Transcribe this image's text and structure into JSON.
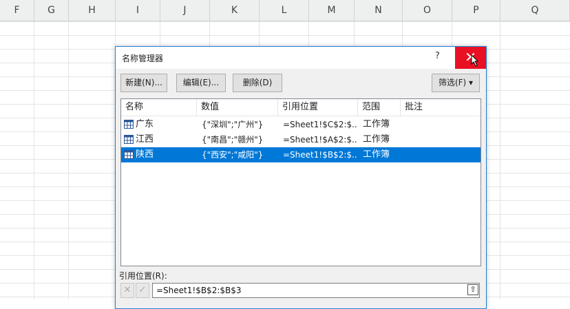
{
  "columns": [
    "F",
    "G",
    "H",
    "I",
    "J",
    "K",
    "L",
    "M",
    "N",
    "O",
    "P",
    "Q"
  ],
  "dialog": {
    "title": "名称管理器",
    "help": "?",
    "close": "✕",
    "buttons": {
      "new": "新建(N)...",
      "edit": "编辑(E)...",
      "delete": "删除(D)",
      "filter": "筛选(F) ▾"
    },
    "headers": [
      "名称",
      "数值",
      "引用位置",
      "范围",
      "批注"
    ],
    "rows": [
      {
        "name": "广东",
        "value": "{\"深圳\";\"广州\"}",
        "ref": "=Sheet1!$C$2:$...",
        "scope": "工作簿",
        "comment": ""
      },
      {
        "name": "江西",
        "value": "{\"南昌\";\"赣州\"}",
        "ref": "=Sheet1!$A$2:$...",
        "scope": "工作簿",
        "comment": ""
      },
      {
        "name": "陕西",
        "value": "{\"西安\";\"咸阳\"}",
        "ref": "=Sheet1!$B$2:$...",
        "scope": "工作簿",
        "comment": ""
      }
    ],
    "selected_row": 2,
    "ref_label": "引用位置(R):",
    "ref_value": "=Sheet1!$B$2:$B$3"
  },
  "colors": {
    "accent": "#0078d7",
    "close": "#e81123"
  },
  "icons": [
    "table-icon",
    "close-icon",
    "help-icon",
    "collapse-icon",
    "cancel-icon",
    "confirm-icon"
  ]
}
